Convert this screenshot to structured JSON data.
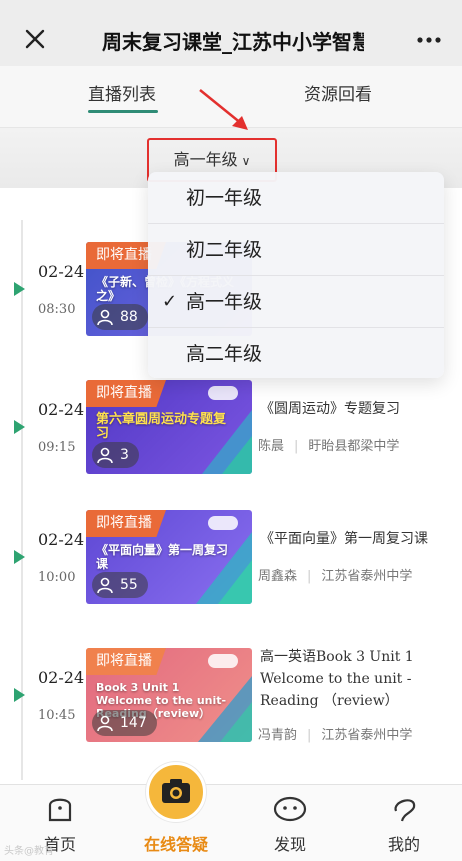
{
  "header": {
    "title": "周末复习课堂_江苏中小学智慧教育",
    "close_icon": "close-icon",
    "more_icon": "more-icon"
  },
  "tabs": [
    {
      "label": "直播列表",
      "active": true
    },
    {
      "label": "资源回看",
      "active": false
    }
  ],
  "filter": {
    "selected": "高一年级",
    "options": [
      "初一年级",
      "初二年级",
      "高一年级",
      "高二年级"
    ],
    "checked": "高一年级",
    "check_mark": "✓"
  },
  "lives": [
    {
      "date": "02-24",
      "time": "08:30",
      "badge": "即将直播",
      "viewers": "88",
      "thumb_subject": "《子新、曾检》《方程式义之》",
      "thumb_color": "#4b60d6"
    },
    {
      "date": "02-24",
      "time": "09:15",
      "badge": "即将直播",
      "viewers": "3",
      "thumb_subject": "第六章圆周运动专题复习",
      "course_title": "《圆周运动》专题复习",
      "teacher": "陈晨",
      "school": "盱眙县都梁中学",
      "thumb_color": "#5d3fd0"
    },
    {
      "date": "02-24",
      "time": "10:00",
      "badge": "即将直播",
      "viewers": "55",
      "thumb_subject": "《平面向量》第一周复习课",
      "course_title": "《平面向量》第一周复习课",
      "teacher": "周鑫森",
      "school": "江苏省泰州中学",
      "thumb_color": "#6a52e0"
    },
    {
      "date": "02-24",
      "time": "10:45",
      "badge": "即将直播",
      "viewers": "147",
      "thumb_subject": "Book 3 Unit 1 Welcome to the unit- Reading（review）",
      "course_title": "高一英语Book 3 Unit 1 Welcome to the unit - Reading （review）",
      "teacher": "冯青韵",
      "school": "江苏省泰州中学",
      "thumb_color": "#e9787a"
    }
  ],
  "separator": "|",
  "bottom_nav": [
    {
      "label": "首页",
      "icon": "home-icon"
    },
    {
      "label": "在线答疑",
      "icon": "camera-icon"
    },
    {
      "label": "发现",
      "icon": "discover-icon"
    },
    {
      "label": "我的",
      "icon": "profile-icon"
    }
  ],
  "watermark": "头条@教育"
}
